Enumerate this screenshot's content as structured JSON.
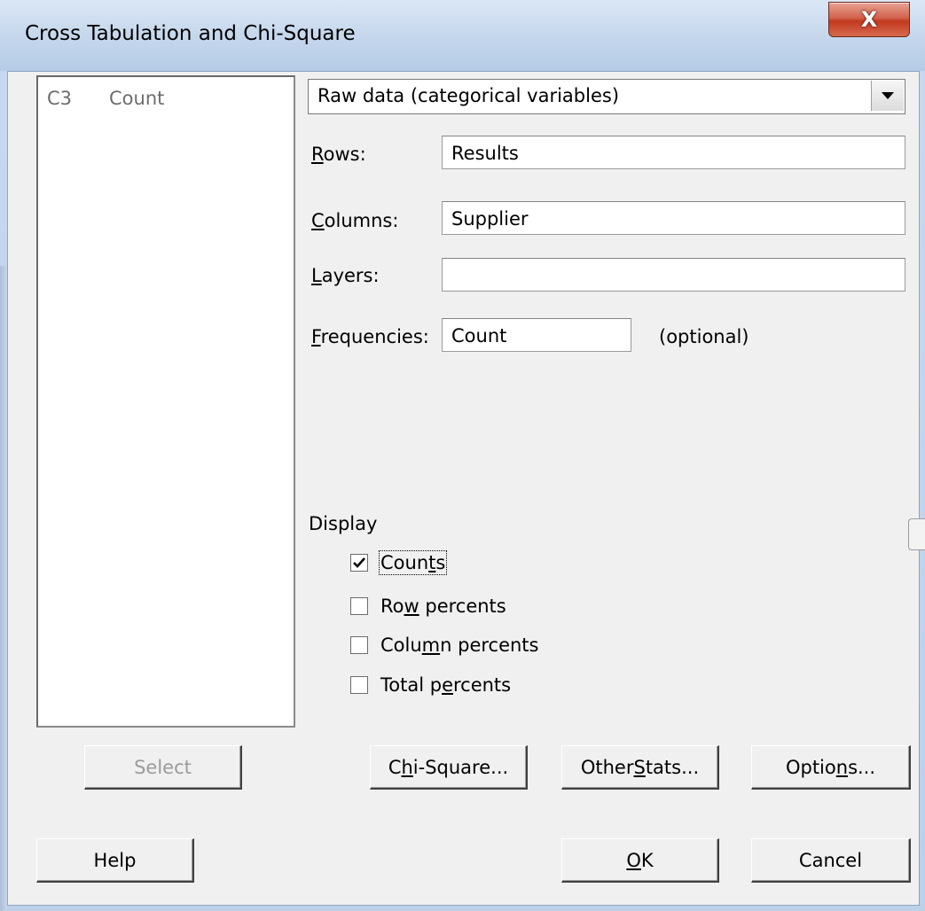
{
  "window": {
    "title": "Cross Tabulation and Chi-Square",
    "close_glyph": "X"
  },
  "variables_list": {
    "items": [
      {
        "column": "C3",
        "name": "Count"
      }
    ]
  },
  "data_type": {
    "selected": "Raw data (categorical variables)"
  },
  "fields": {
    "rows": {
      "label_mnemonic": "R",
      "label_rest": "ows:",
      "value": "Results"
    },
    "columns": {
      "label_mnemonic": "C",
      "label_rest": "olumns:",
      "value": "Supplier"
    },
    "layers": {
      "label_mnemonic": "L",
      "label_rest": "ayers:",
      "value": ""
    },
    "frequencies": {
      "label_mnemonic": "F",
      "label_rest": "requencies:",
      "value": "Count",
      "note": "(optional)"
    }
  },
  "display": {
    "label": "Display",
    "options": [
      {
        "pre": "Coun",
        "mn": "t",
        "post": "s",
        "checked": true
      },
      {
        "pre": "Ro",
        "mn": "w",
        "post": " percents",
        "checked": false
      },
      {
        "pre": "Colu",
        "mn": "m",
        "post": "n percents",
        "checked": false
      },
      {
        "pre": "Total p",
        "mn": "e",
        "post": "rcents",
        "checked": false
      }
    ]
  },
  "buttons": {
    "select": "Select",
    "chi_square": {
      "pre": "C",
      "mn": "h",
      "post": "i-Square..."
    },
    "other_stats": {
      "pre": "Other ",
      "mn": "S",
      "post": "tats..."
    },
    "options": {
      "pre": "Optio",
      "mn": "n",
      "post": "s..."
    },
    "help": "Help",
    "ok": {
      "pre": "",
      "mn": "O",
      "post": "K"
    },
    "cancel": "Cancel"
  }
}
